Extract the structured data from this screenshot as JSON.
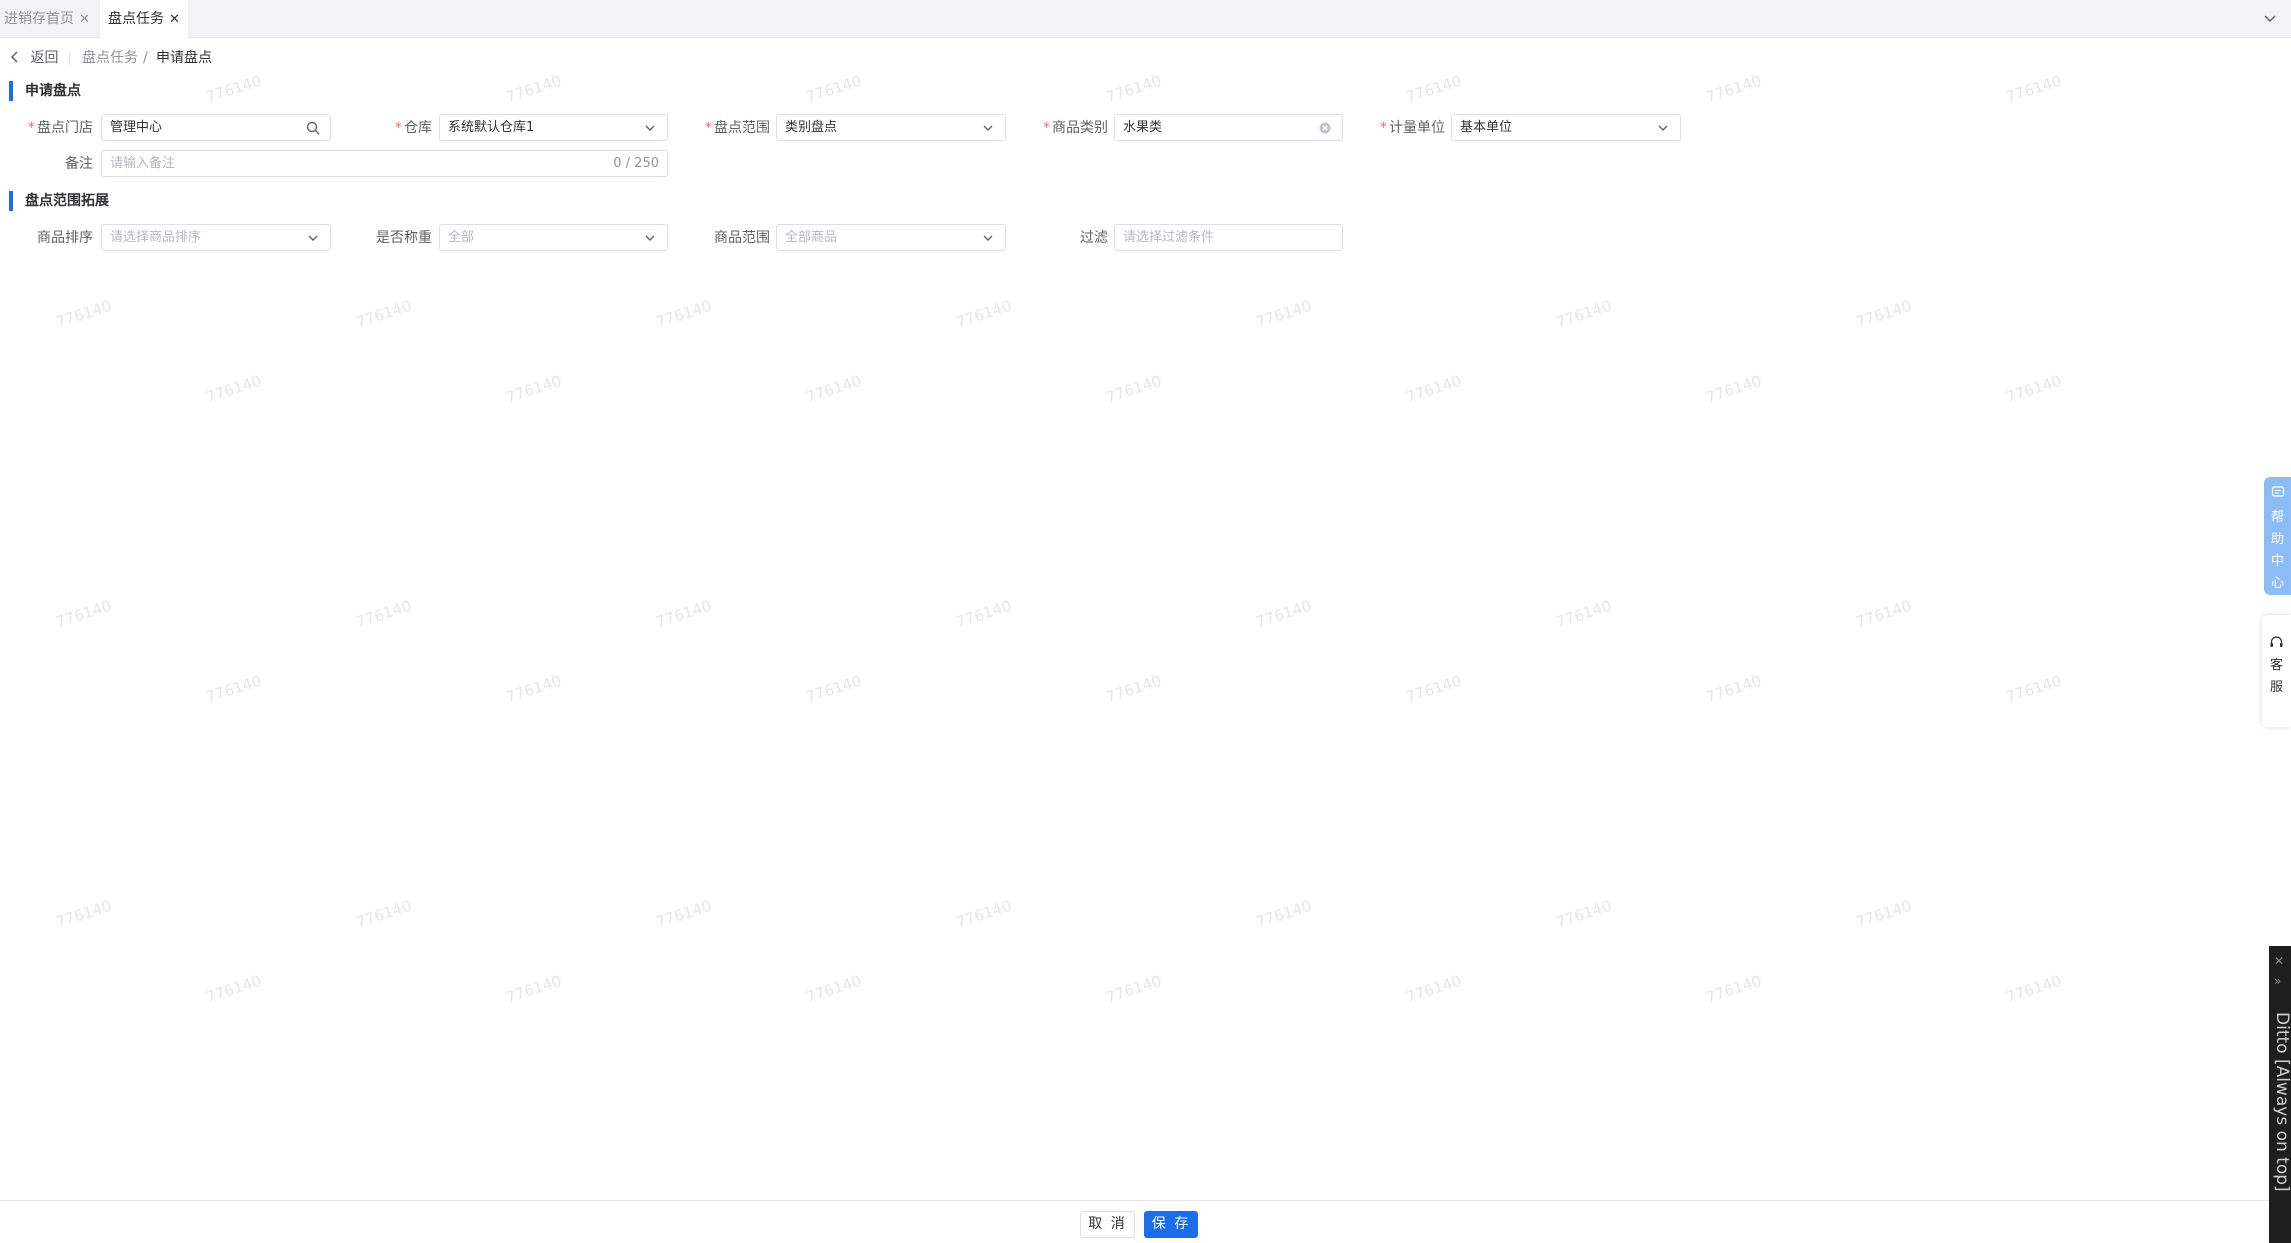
{
  "tabs": [
    {
      "label": "进销存首页",
      "active": false
    },
    {
      "label": "盘点任务",
      "active": true
    }
  ],
  "breadcrumb": {
    "back": "返回",
    "parent": "盘点任务",
    "separator": "/",
    "current": "申请盘点"
  },
  "section1": {
    "title": "申请盘点",
    "store": {
      "label": "盘点门店",
      "value": "管理中心"
    },
    "warehouse": {
      "label": "仓库",
      "value": "系统默认仓库1"
    },
    "scope": {
      "label": "盘点范围",
      "value": "类别盘点"
    },
    "category": {
      "label": "商品类别",
      "value": "水果类"
    },
    "unit": {
      "label": "计量单位",
      "value": "基本单位"
    },
    "remark": {
      "label": "备注",
      "placeholder": "请输入备注",
      "count": "0 / 250"
    }
  },
  "section2": {
    "title": "盘点范围拓展",
    "sort": {
      "label": "商品排序",
      "placeholder": "请选择商品排序"
    },
    "weigh": {
      "label": "是否称重",
      "value": "全部"
    },
    "goods_scope": {
      "label": "商品范围",
      "value": "全部商品"
    },
    "filter": {
      "label": "过滤",
      "placeholder": "请选择过滤条件"
    }
  },
  "watermark": "776140",
  "side": {
    "help": [
      "帮",
      "助",
      "中",
      "心"
    ],
    "service": [
      "客",
      "服"
    ]
  },
  "ditto": {
    "label": "Ditto [Always on top]"
  },
  "footer": {
    "cancel": "取 消",
    "save": "保 存"
  },
  "colors": {
    "primary": "#1a6fe8",
    "required": "#f56c6c",
    "border": "#dcdfe6"
  }
}
